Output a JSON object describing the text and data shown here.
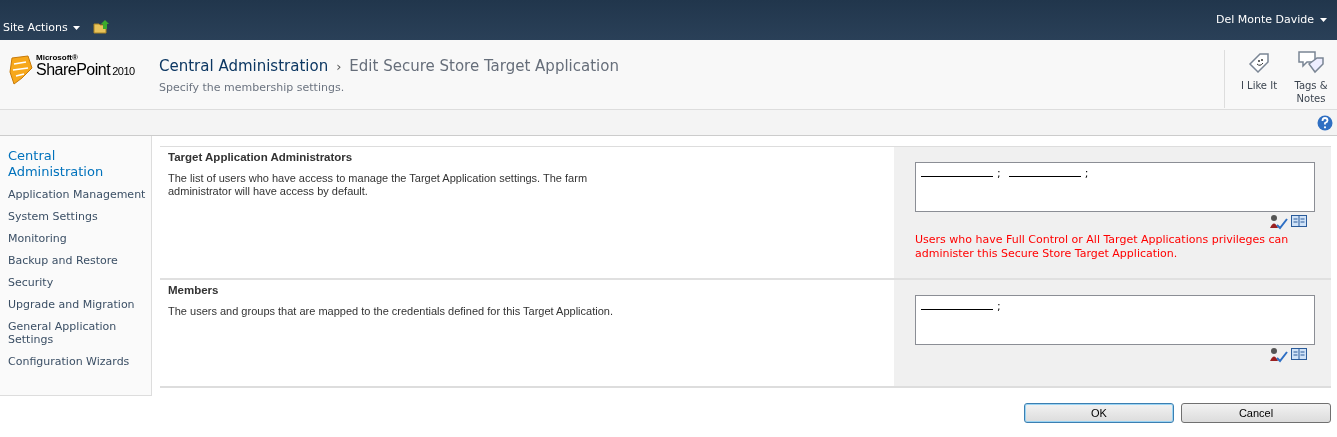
{
  "top_bar": {
    "site_actions": "Site Actions",
    "user": "Del Monte Davide"
  },
  "header": {
    "logo": {
      "small": "Microsoft®",
      "name": "SharePoint",
      "year": "2010"
    },
    "breadcrumb_root": "Central Administration",
    "breadcrumb_separator": "›",
    "title": "Edit Secure Store Target Application",
    "subtitle": "Specify the membership settings."
  },
  "social": [
    {
      "label": "I Like It",
      "kind": "like"
    },
    {
      "label": "Tags & Notes",
      "kind": "tags"
    }
  ],
  "sidebar": {
    "heading": "Central Administration",
    "items": [
      "Application Management",
      "System Settings",
      "Monitoring",
      "Backup and Restore",
      "Security",
      "Upgrade and Migration",
      "General Application Settings",
      "Configuration Wizards"
    ]
  },
  "sections": [
    {
      "title": "Target Application Administrators",
      "description": "The list of users who have access to manage the Target Application settings. The farm administrator will have access by default.",
      "entries": [
        {
          "separator": ";"
        },
        {
          "separator": ";"
        }
      ],
      "note": "Users who have Full Control or All Target Applications privileges can administer this Secure Store Target Application."
    },
    {
      "title": "Members",
      "description": "The users and groups that are mapped to the credentials defined for this Target Application.",
      "entries": [
        {
          "separator": ";"
        }
      ]
    }
  ],
  "buttons": [
    {
      "label": "OK",
      "kind": "primary"
    },
    {
      "label": "Cancel",
      "kind": "secondary"
    }
  ]
}
